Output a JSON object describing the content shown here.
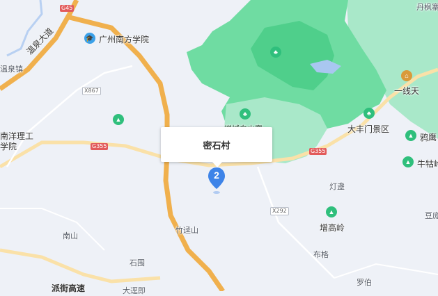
{
  "map": {
    "colors": {
      "background": "#eef1f7",
      "forest": "#6fdca2",
      "forest_dark": "#4fcf8b",
      "forest_light": "#a9e8c9",
      "road_major": "#f0b04d",
      "road_minor": "#fae1a8",
      "road_local": "#ffffff",
      "water": "#a9c7f0",
      "marker": "#3e84e8"
    },
    "shields": {
      "g45": "G45",
      "x867": "X867",
      "g355_west": "G355",
      "g355_east": "G355",
      "x292": "X292"
    },
    "labels": {
      "south_university": "广州南方学院",
      "wenquan_ave": "温泉大道",
      "wenquan_town": "温泉镇",
      "nanyang_a": "南洋理工",
      "nanyang_b": "学院",
      "zengcheng_reservoir": "增城白水寨",
      "danfeng": "丹枫寨",
      "yixiantian": "一线天",
      "dafengmen": "大丰门景区",
      "yaying": "鸦鹰",
      "niuguling": "牛牯岭",
      "dengsheng": "灯盏",
      "zenggaoling": "增高岭",
      "douchang": "豆庞",
      "buge": "布格",
      "luobo": "罗伯",
      "nanshan": "南山",
      "shiwei": "石围",
      "zhuxing": "竹迳山",
      "paijie": "派街高速",
      "dayong": "大逕即"
    },
    "marker": {
      "count": "2",
      "popup_title": "密石村"
    }
  }
}
